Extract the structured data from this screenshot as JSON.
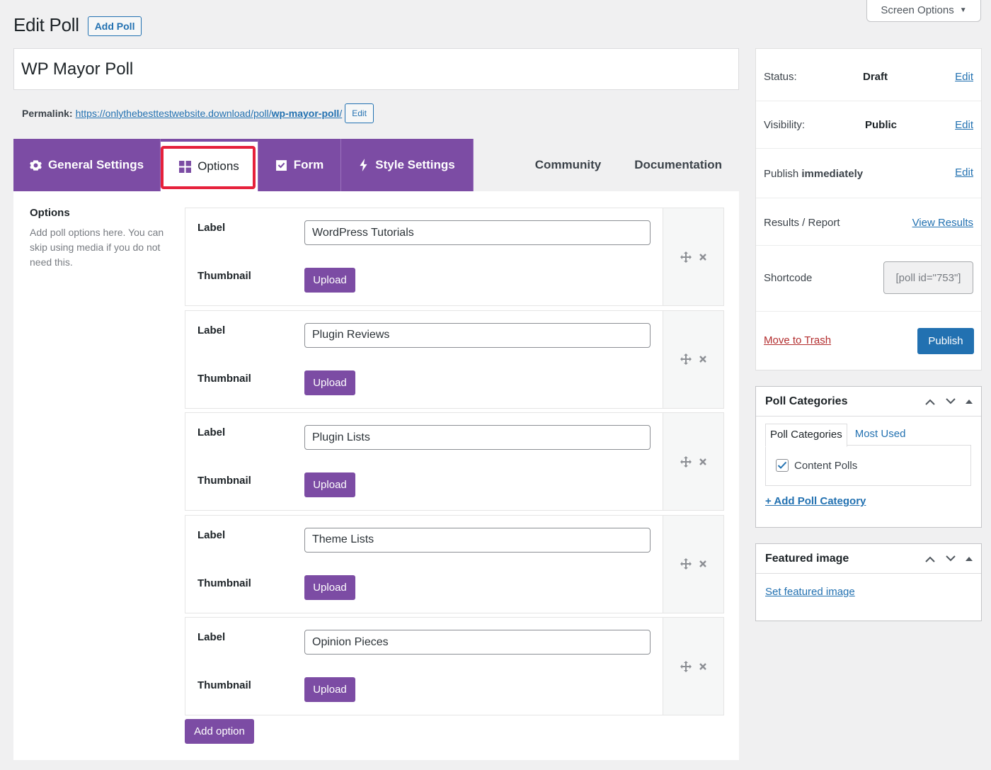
{
  "screen_options": {
    "label": "Screen Options",
    "caret": "▼"
  },
  "header": {
    "title": "Edit Poll",
    "add_button": "Add Poll"
  },
  "poll_title": "WP Mayor Poll",
  "permalink": {
    "label": "Permalink:",
    "url_base": "https://onlythebesttestwebsite.download/poll/",
    "slug": "wp-mayor-poll",
    "url_trail": "/",
    "edit_label": "Edit"
  },
  "tabs": [
    {
      "label": "General Settings",
      "icon": "gear-icon"
    },
    {
      "label": "Options",
      "icon": "grid-icon"
    },
    {
      "label": "Form",
      "icon": "checkbox-icon"
    },
    {
      "label": "Style Settings",
      "icon": "bolt-icon"
    }
  ],
  "tab_links": [
    "Community",
    "Documentation"
  ],
  "options_section": {
    "title": "Options",
    "description": "Add poll options here. You can skip using media if you do not need this."
  },
  "option_field_labels": {
    "label": "Label",
    "thumbnail": "Thumbnail",
    "upload": "Upload"
  },
  "options": [
    {
      "value": "WordPress Tutorials"
    },
    {
      "value": "Plugin Reviews"
    },
    {
      "value": "Plugin Lists"
    },
    {
      "value": "Theme Lists"
    },
    {
      "value": "Opinion Pieces"
    }
  ],
  "add_option_label": "Add option",
  "publish": {
    "status_label": "Status:",
    "status_value": "Draft",
    "status_edit": "Edit",
    "visibility_label": "Visibility:",
    "visibility_value": "Public",
    "visibility_edit": "Edit",
    "publish_label": "Publish",
    "publish_value": "immediately",
    "publish_edit": "Edit",
    "results_label": "Results / Report",
    "results_link": "View Results",
    "shortcode_label": "Shortcode",
    "shortcode_value": "[poll id=\"753\"]",
    "trash_label": "Move to Trash",
    "publish_button": "Publish"
  },
  "poll_categories": {
    "title": "Poll Categories",
    "tab_all": "Poll Categories",
    "tab_most_used": "Most Used",
    "items": [
      {
        "label": "Content Polls",
        "checked": true
      }
    ],
    "add_link": "+ Add Poll Category"
  },
  "featured_image": {
    "title": "Featured image",
    "link": "Set featured image"
  },
  "colors": {
    "purple": "#7c4ca4",
    "wp_blue": "#2271b1",
    "highlight_red": "#e6213b",
    "trash_red": "#b32d2e"
  }
}
